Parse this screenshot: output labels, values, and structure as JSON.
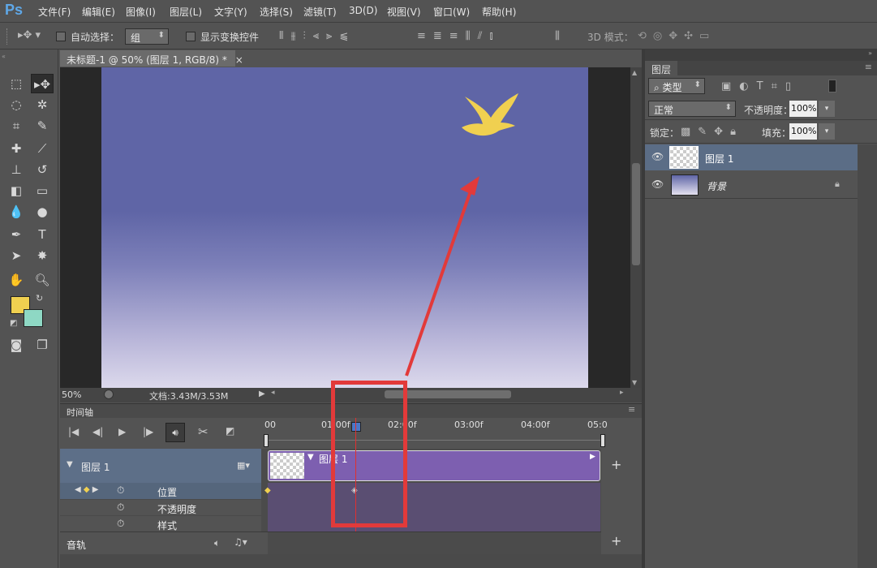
{
  "app": {
    "logo": "Ps"
  },
  "menu": [
    "文件(F)",
    "编辑(E)",
    "图像(I)",
    "图层(L)",
    "文字(Y)",
    "选择(S)",
    "滤镜(T)",
    "3D(D)",
    "视图(V)",
    "窗口(W)",
    "帮助(H)"
  ],
  "options": {
    "auto_select_label": "自动选择：",
    "auto_select_value": "组",
    "show_transform_label": "显示变换控件",
    "mode3d_label": "3D 模式："
  },
  "document": {
    "tab_title": "未标题-1 @ 50% (图层 1, RGB/8) *",
    "close": "×",
    "zoom": "50%",
    "doc_info": "文档:3.43M/3.53M"
  },
  "timeline": {
    "title": "时间轴",
    "ruler": [
      "00",
      "01:00f",
      "02:00f",
      "03:00f",
      "04:00f",
      "05:0"
    ],
    "layer_name": "图层 1",
    "clip_label": "图层 1",
    "properties": [
      "位置",
      "不透明度",
      "样式"
    ],
    "audio_label": "音轨",
    "add": "+"
  },
  "layers_panel": {
    "tab": "图层",
    "filter_label": "类型",
    "blend_mode": "正常",
    "opacity_label": "不透明度：",
    "opacity_value": "100%",
    "lock_label": "锁定：",
    "fill_label": "填充：",
    "fill_value": "100%",
    "layers": [
      {
        "name": "图层 1"
      },
      {
        "name": "背景"
      }
    ]
  },
  "colors": {
    "foreground": "#f0d050",
    "background": "#8ed8c4",
    "clip": "#7d5fb0",
    "highlight_box": "#e23a3a"
  }
}
